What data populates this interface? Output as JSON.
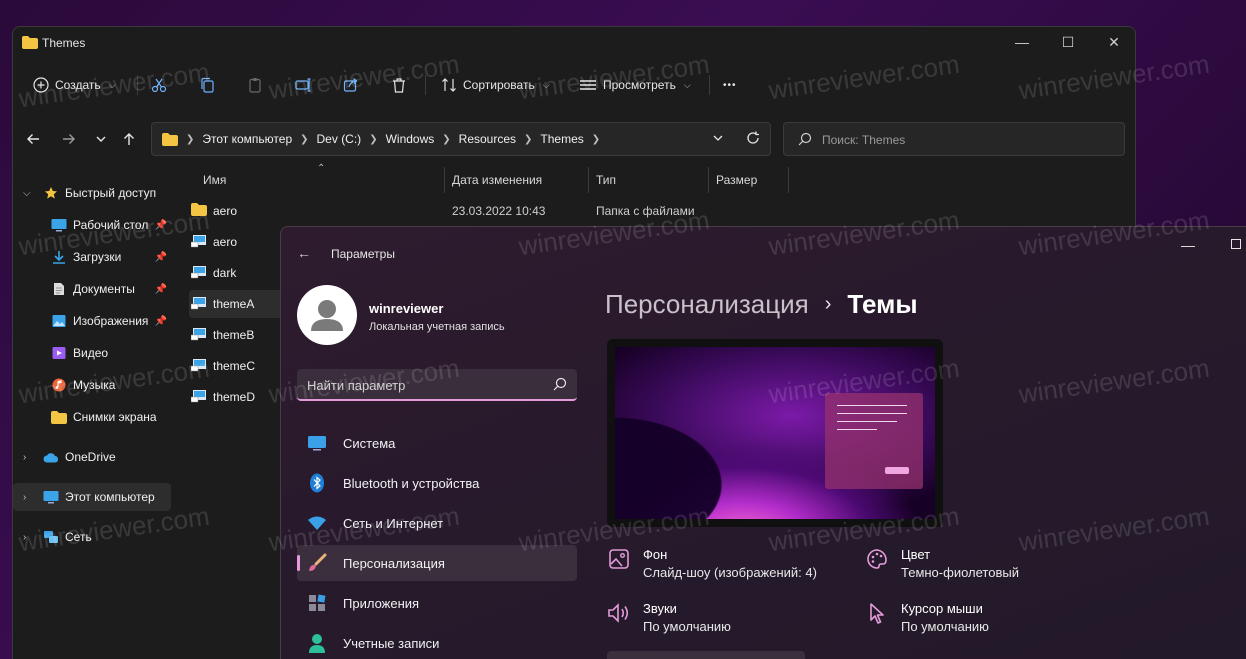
{
  "explorer": {
    "title": "Themes",
    "caption": {
      "minimize": "—",
      "maximize": "☐",
      "close": "✕"
    },
    "toolbar": {
      "create": "Создать",
      "sort": "Сортировать",
      "view": "Просмотреть",
      "more": "•••"
    },
    "address": {
      "crumbs": [
        "Этот компьютер",
        "Dev (C:)",
        "Windows",
        "Resources",
        "Themes"
      ]
    },
    "search_placeholder": "Поиск: Themes",
    "sidebar": {
      "quick_access": "Быстрый доступ",
      "items": [
        {
          "label": "Рабочий стол",
          "pinned": true
        },
        {
          "label": "Загрузки",
          "pinned": true
        },
        {
          "label": "Документы",
          "pinned": true
        },
        {
          "label": "Изображения",
          "pinned": true
        },
        {
          "label": "Видео",
          "pinned": false
        },
        {
          "label": "Музыка",
          "pinned": false
        },
        {
          "label": "Снимки экрана",
          "pinned": false
        }
      ],
      "onedrive": "OneDrive",
      "this_pc": "Этот компьютер",
      "network": "Сеть"
    },
    "columns": {
      "name": "Имя",
      "date": "Дата изменения",
      "type": "Тип",
      "size": "Размер"
    },
    "files": [
      {
        "name": "aero",
        "date": "23.03.2022 10:43",
        "type": "Папка с файлами",
        "kind": "folder"
      },
      {
        "name": "aero",
        "kind": "theme"
      },
      {
        "name": "dark",
        "kind": "theme"
      },
      {
        "name": "themeA",
        "kind": "theme"
      },
      {
        "name": "themeB",
        "kind": "theme"
      },
      {
        "name": "themeC",
        "kind": "theme"
      },
      {
        "name": "themeD",
        "kind": "theme"
      }
    ]
  },
  "settings": {
    "title": "Параметры",
    "user": {
      "name": "winreviewer",
      "subtitle": "Локальная учетная запись"
    },
    "search_placeholder": "Найти параметр",
    "nav": [
      {
        "label": "Система"
      },
      {
        "label": "Bluetooth и устройства"
      },
      {
        "label": "Сеть и Интернет"
      },
      {
        "label": "Персонализация"
      },
      {
        "label": "Приложения"
      },
      {
        "label": "Учетные записи"
      }
    ],
    "breadcrumb": {
      "parent": "Персонализация",
      "separator": "›",
      "current": "Темы"
    },
    "props": {
      "background": {
        "label": "Фон",
        "value": "Слайд-шоу (изображений: 4)"
      },
      "color": {
        "label": "Цвет",
        "value": "Темно-фиолетовый"
      },
      "sounds": {
        "label": "Звуки",
        "value": "По умолчанию"
      },
      "cursor": {
        "label": "Курсор мыши",
        "value": "По умолчанию"
      }
    }
  },
  "watermark": "winreviewer.com",
  "colors": {
    "accent": "#e39bd9",
    "folder": "#f4c542"
  }
}
